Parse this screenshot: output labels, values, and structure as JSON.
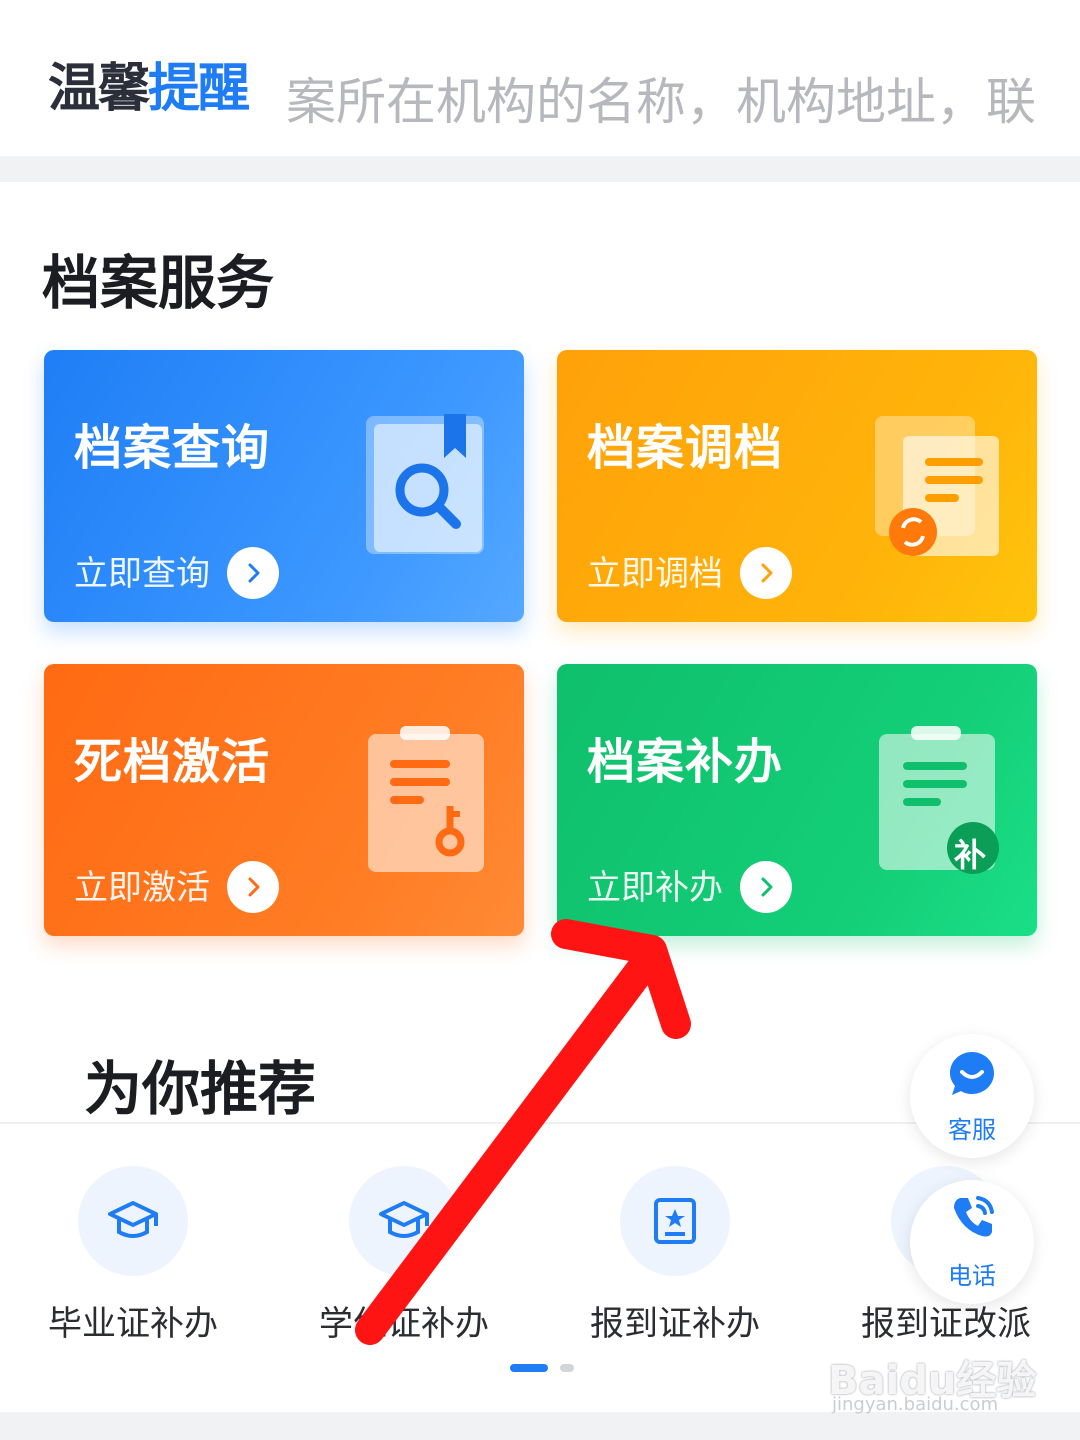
{
  "notice": {
    "logo_part1": "温馨",
    "logo_part2": "提醒",
    "text": "案所在机构的名称，机构地址，联"
  },
  "archive_services": {
    "title": "档案服务",
    "cards": [
      {
        "title": "档案查询",
        "action": "立即查询",
        "icon": "search-document-icon",
        "color": "#1f7ef6"
      },
      {
        "title": "档案调档",
        "action": "立即调档",
        "icon": "transfer-document-icon",
        "color": "#ffa10a"
      },
      {
        "title": "死档激活",
        "action": "立即激活",
        "icon": "key-clipboard-icon",
        "color": "#ff6a12"
      },
      {
        "title": "档案补办",
        "action": "立即补办",
        "icon": "reissue-clipboard-icon",
        "color": "#0fbf6b",
        "badge": "补"
      }
    ]
  },
  "recommend": {
    "title": "为你推荐",
    "items": [
      {
        "label": "毕业证补办",
        "icon": "graduation-cap-icon"
      },
      {
        "label": "学位证补办",
        "icon": "graduation-cap-icon"
      },
      {
        "label": "报到证补办",
        "icon": "certificate-icon"
      },
      {
        "label": "报到证改派",
        "icon": "certificate-icon"
      }
    ]
  },
  "floating": {
    "customer_service": "客服",
    "phone": "电话"
  },
  "watermark": {
    "brand": "Baidu经验",
    "url": "jingyan.baidu.com"
  },
  "accent_color": "#1e7cf5",
  "annotation_color": "#ff1414"
}
